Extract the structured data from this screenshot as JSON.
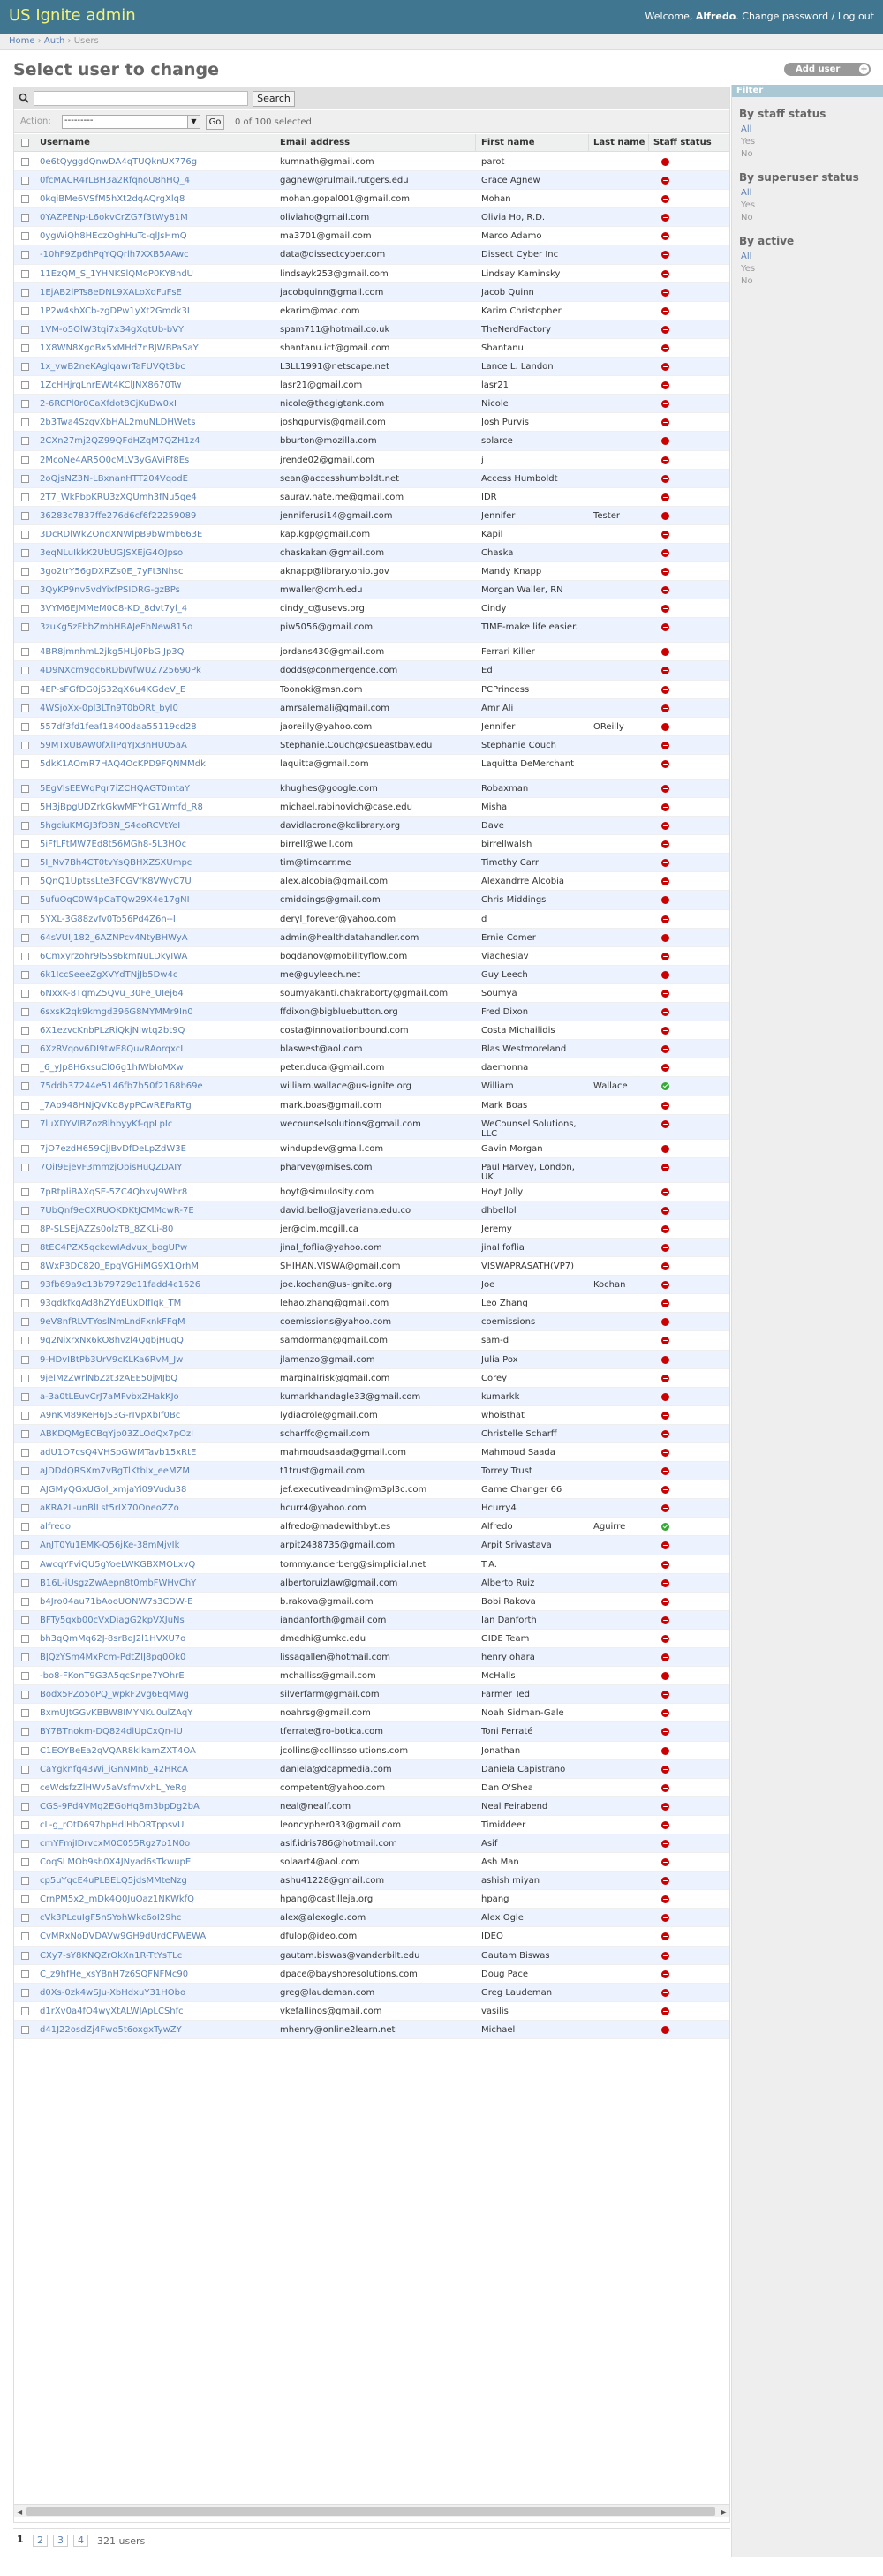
{
  "header": {
    "brand": "US Ignite admin",
    "welcome": "Welcome,",
    "user": "Alfredo",
    "change_password": "Change password",
    "sep": "/",
    "logout": "Log out"
  },
  "breadcrumbs": {
    "home": "Home",
    "auth": "Auth",
    "users": "Users",
    "sep": "›"
  },
  "page": {
    "title": "Select user to change",
    "add_button": "Add user",
    "add_icon": "plus-icon"
  },
  "search": {
    "button": "Search",
    "value": ""
  },
  "actions": {
    "label": "Action:",
    "select_value": "---------",
    "go": "Go",
    "selection_count": "0 of 100 selected"
  },
  "columns": {
    "username": "Username",
    "email": "Email address",
    "first": "First name",
    "last": "Last name",
    "staff": "Staff status"
  },
  "rows": [
    {
      "u": "0e6tQyggdQnwDA4qTUQknUX776g",
      "e": "kumnath@gmail.com",
      "f": "parot",
      "l": "",
      "s": false
    },
    {
      "u": "0fcMACR4rLBH3a2RfqnoU8hHQ_4",
      "e": "gagnew@rulmail.rutgers.edu",
      "f": "Grace Agnew",
      "l": "",
      "s": false
    },
    {
      "u": "0kqiBMe6VSfM5hXt2dqAQrgXlq8",
      "e": "mohan.gopal001@gmail.com",
      "f": "Mohan",
      "l": "",
      "s": false
    },
    {
      "u": "0YAZPENp-L6okvCrZG7f3tWy81M",
      "e": "oliviaho@gmail.com",
      "f": "Olivia Ho, R.D.",
      "l": "",
      "s": false
    },
    {
      "u": "0ygWiQh8HEczOghHuTc-qlJsHmQ",
      "e": "ma3701@gmail.com",
      "f": "Marco Adamo",
      "l": "",
      "s": false
    },
    {
      "u": "-10hF9Zp6hPqYQQrlh7XXB5AAwc",
      "e": "data@dissectcyber.com",
      "f": "Dissect Cyber Inc",
      "l": "",
      "s": false
    },
    {
      "u": "11EzQM_S_1YHNKSlQMoP0KY8ndU",
      "e": "lindsayk253@gmail.com",
      "f": "Lindsay Kaminsky",
      "l": "",
      "s": false
    },
    {
      "u": "1EjAB2lPTs8eDNL9XALoXdFuFsE",
      "e": "jacobquinn@gmail.com",
      "f": "Jacob Quinn",
      "l": "",
      "s": false
    },
    {
      "u": "1P2w4shXCb-zgDPw1yXt2Gmdk3I",
      "e": "ekarim@mac.com",
      "f": "Karim Christopher",
      "l": "",
      "s": false
    },
    {
      "u": "1VM-o5OlW3tqi7x34gXqtUb-bVY",
      "e": "spam711@hotmail.co.uk",
      "f": "TheNerdFactory",
      "l": "",
      "s": false
    },
    {
      "u": "1X8WN8XgoBx5xMHd7nBJWBPaSaY",
      "e": "shantanu.ict@gmail.com",
      "f": "Shantanu",
      "l": "",
      "s": false
    },
    {
      "u": "1x_vwB2neKAglqawrTaFUVQt3bc",
      "e": "L3LL1991@netscape.net",
      "f": "Lance L. Landon",
      "l": "",
      "s": false
    },
    {
      "u": "1ZcHHjrqLnrEWt4KClJNX8670Tw",
      "e": "lasr21@gmail.com",
      "f": "lasr21",
      "l": "",
      "s": false
    },
    {
      "u": "2-6RCPl0r0CaXfdot8CjKuDw0xI",
      "e": "nicole@thegigtank.com",
      "f": "Nicole",
      "l": "",
      "s": false
    },
    {
      "u": "2b3Twa4SzgvXbHAL2muNLDHWets",
      "e": "joshgpurvis@gmail.com",
      "f": "Josh Purvis",
      "l": "",
      "s": false
    },
    {
      "u": "2CXn27mj2QZ99QFdHZqM7QZH1z4",
      "e": "bburton@mozilla.com",
      "f": "solarce",
      "l": "",
      "s": false
    },
    {
      "u": "2McoNe4AR5O0cMLV3yGAViFf8Es",
      "e": "jrende02@gmail.com",
      "f": "j",
      "l": "",
      "s": false
    },
    {
      "u": "2oQjsNZ3N-LBxnanHTT204VqodE",
      "e": "sean@accesshumboldt.net",
      "f": "Access Humboldt",
      "l": "",
      "s": false
    },
    {
      "u": "2T7_WkPbpKRU3zXQUmh3fNu5ge4",
      "e": "saurav.hate.me@gmail.com",
      "f": "IDR",
      "l": "",
      "s": false
    },
    {
      "u": "36283c7837ffe276d6cf6f22259089",
      "e": "jenniferusi14@gmail.com",
      "f": "Jennifer",
      "l": "Tester",
      "s": false
    },
    {
      "u": "3DcRDlWkZOndXNWlpB9bWmb663E",
      "e": "kap.kgp@gmail.com",
      "f": "Kapil",
      "l": "",
      "s": false
    },
    {
      "u": "3eqNLuIkkK2UbUGJSXEjG4OJpso",
      "e": "chaskakani@gmail.com",
      "f": "Chaska",
      "l": "",
      "s": false
    },
    {
      "u": "3go2trY56gDXRZs0E_7yFt3Nhsc",
      "e": "aknapp@library.ohio.gov",
      "f": "Mandy Knapp",
      "l": "",
      "s": false
    },
    {
      "u": "3QyKP9nv5vdYixfPSIDRG-gzBPs",
      "e": "mwaller@cmh.edu",
      "f": "Morgan Waller, RN",
      "l": "",
      "s": false
    },
    {
      "u": "3VYM6EJMMeM0C8-KD_8dvt7yl_4",
      "e": "cindy_c@usevs.org",
      "f": "Cindy",
      "l": "",
      "s": false
    },
    {
      "u": "3zuKg5zFbbZmbHBAJeFhNew815o",
      "e": "piw5056@gmail.com",
      "f": "TIME-make life easier.",
      "l": "",
      "s": false,
      "tall": true
    },
    {
      "u": "4BR8jmnhmL2jkg5HLj0PbGIJp3Q",
      "e": "jordans430@gmail.com",
      "f": "Ferrari Killer",
      "l": "",
      "s": false
    },
    {
      "u": "4D9NXcm9gc6RDbWfWUZ725690Pk",
      "e": "dodds@conmergence.com",
      "f": "Ed",
      "l": "",
      "s": false
    },
    {
      "u": "4EP-sFGfDG0jS32qX6u4KGdeV_E",
      "e": "Toonoki@msn.com",
      "f": "PCPrincess",
      "l": "",
      "s": false
    },
    {
      "u": "4WSjoXx-0pl3LTn9T0bORt_byI0",
      "e": "amrsalemali@gmail.com",
      "f": "Amr Ali",
      "l": "",
      "s": false
    },
    {
      "u": "557df3fd1feaf18400daa55119cd28",
      "e": "jaoreilly@yahoo.com",
      "f": "Jennifer",
      "l": "OReilly",
      "s": false
    },
    {
      "u": "59MTxUBAW0fXlIPgYJx3nHU05aA",
      "e": "Stephanie.Couch@csueastbay.edu",
      "f": "Stephanie Couch",
      "l": "",
      "s": false
    },
    {
      "u": "5dkK1AOmR7HAQ4OcKPD9FQNMMdk",
      "e": "laquitta@gmail.com",
      "f": "Laquitta DeMerchant",
      "l": "",
      "s": false,
      "tall": true
    },
    {
      "u": "5EgVlsEEWqPqr7iZCHQAGT0mtaY",
      "e": "khughes@google.com",
      "f": "Robaxman",
      "l": "",
      "s": false
    },
    {
      "u": "5H3jBpgUDZrkGkwMFYhG1Wmfd_R8",
      "e": "michael.rabinovich@case.edu",
      "f": "Misha",
      "l": "",
      "s": false
    },
    {
      "u": "5hgciuKMGJ3fO8N_S4eoRCVtYeI",
      "e": "davidlacrone@kclibrary.org",
      "f": "Dave",
      "l": "",
      "s": false
    },
    {
      "u": "5iFfLFtMW7Ed8t56MGh8-5L3HOc",
      "e": "birrell@well.com",
      "f": "birrellwalsh",
      "l": "",
      "s": false
    },
    {
      "u": "5I_Nv7Bh4CT0tvYsQBHXZSXUmpc",
      "e": "tim@timcarr.me",
      "f": "Timothy Carr",
      "l": "",
      "s": false
    },
    {
      "u": "5QnQ1UptssLte3FCGVfK8VWyC7U",
      "e": "alex.alcobia@gmail.com",
      "f": "Alexandrre Alcobia",
      "l": "",
      "s": false
    },
    {
      "u": "5ufuOqC0W4pCaTQw29X4e17gNI",
      "e": "cmiddings@gmail.com",
      "f": "Chris Middings",
      "l": "",
      "s": false
    },
    {
      "u": "5YXL-3G88zvfv0To56Pd4Z6n--I",
      "e": "deryl_forever@yahoo.com",
      "f": "d",
      "l": "",
      "s": false
    },
    {
      "u": "64sVUIJ182_6AZNPcv4NtyBHWyA",
      "e": "admin@healthdatahandler.com",
      "f": "Ernie Comer",
      "l": "",
      "s": false
    },
    {
      "u": "6Cmxyrzohr9lSSs6kmNuLDkyIWA",
      "e": "bogdanov@mobilityflow.com",
      "f": "Viacheslav",
      "l": "",
      "s": false
    },
    {
      "u": "6k1IccSeeeZgXVYdTNjJb5Dw4c",
      "e": "me@guyleech.net",
      "f": "Guy Leech",
      "l": "",
      "s": false
    },
    {
      "u": "6NxxK-8TqmZ5Qvu_30Fe_UIej64",
      "e": "soumyakanti.chakraborty@gmail.com",
      "f": "Soumya",
      "l": "",
      "s": false
    },
    {
      "u": "6sxsK2qk9kmgd396G8MYMMr9In0",
      "e": "ffdixon@bigbluebutton.org",
      "f": "Fred Dixon",
      "l": "",
      "s": false
    },
    {
      "u": "6X1ezvcKnbPLzRiQkjNIwtq2bt9Q",
      "e": "costa@innovationbound.com",
      "f": "Costa Michailidis",
      "l": "",
      "s": false
    },
    {
      "u": "6XzRVqov6DI9twE8QuvRAorqxcI",
      "e": "blaswest@aol.com",
      "f": "Blas Westmoreland",
      "l": "",
      "s": false
    },
    {
      "u": "_6_yJp8H6xsuCl06g1hIWbIoMXw",
      "e": "peter.ducai@gmail.com",
      "f": "daemonna",
      "l": "",
      "s": false
    },
    {
      "u": "75ddb37244e5146fb7b50f2168b69e",
      "e": "william.wallace@us-ignite.org",
      "f": "William",
      "l": "Wallace",
      "s": true
    },
    {
      "u": "_7Ap948HNjQVKq8ypPCwREFaRTg",
      "e": "mark.boas@gmail.com",
      "f": "Mark Boas",
      "l": "",
      "s": false
    },
    {
      "u": "7luXDYVIBZoz8lhbyyKf-qpLpIc",
      "e": "wecounselsolutions@gmail.com",
      "f": "WeCounsel Solutions, LLC",
      "l": "",
      "s": false,
      "tall": true
    },
    {
      "u": "7jO7ezdH659CjJBvDfDeLpZdW3E",
      "e": "windupdev@gmail.com",
      "f": "Gavin Morgan",
      "l": "",
      "s": false
    },
    {
      "u": "7OiI9EjevF3mmzjOpisHuQZDAIY",
      "e": "pharvey@mises.com",
      "f": "Paul Harvey, London, UK",
      "l": "",
      "s": false,
      "tall": true
    },
    {
      "u": "7pRtpliBAXqSE-5ZC4QhxvJ9Wbr8",
      "e": "hoyt@simulosity.com",
      "f": "Hoyt Jolly",
      "l": "",
      "s": false
    },
    {
      "u": "7UbQnf9eCXRUOKDKtJCMMcwR-7E",
      "e": "david.bello@javeriana.edu.co",
      "f": "dhbellol",
      "l": "",
      "s": false
    },
    {
      "u": "8P-SLSEjAZZs0olzT8_8ZKLi-80",
      "e": "jer@cim.mcgill.ca",
      "f": "Jeremy",
      "l": "",
      "s": false
    },
    {
      "u": "8tEC4PZX5qckewIAdvux_bogUPw",
      "e": "jinal_foflia@yahoo.com",
      "f": "jinal foflia",
      "l": "",
      "s": false
    },
    {
      "u": "8WxP3DC820_EpqVGHiMG9X1QrhM",
      "e": "SHIHAN.VISWA@gmail.com",
      "f": "VISWAPRASATH(VP7)",
      "l": "",
      "s": false
    },
    {
      "u": "93fb69a9c13b79729c11fadd4c1626",
      "e": "joe.kochan@us-ignite.org",
      "f": "Joe",
      "l": "Kochan",
      "s": false
    },
    {
      "u": "93gdkfkqAd8hZYdEUxDlfIqk_TM",
      "e": "lehao.zhang@gmail.com",
      "f": "Leo Zhang",
      "l": "",
      "s": false
    },
    {
      "u": "9eV8nfRLVTYoslNmLndFxnkFFqM",
      "e": "coemissions@yahoo.com",
      "f": "coemissions",
      "l": "",
      "s": false
    },
    {
      "u": "9g2NixrxNx6kO8hvzl4QgbjHugQ",
      "e": "samdorman@gmail.com",
      "f": "sam-d",
      "l": "",
      "s": false
    },
    {
      "u": "9-HDvIBtPb3UrV9cKLKa6RvM_Jw",
      "e": "jlamenzo@gmail.com",
      "f": "Julia Pox",
      "l": "",
      "s": false
    },
    {
      "u": "9jelMzZwrlNbZzt3zAEE50jMJbQ",
      "e": "marginalrisk@gmail.com",
      "f": "Corey",
      "l": "",
      "s": false
    },
    {
      "u": "a-3a0tLEuvCrJ7aMFvbxZHakKJo",
      "e": "kumarkhandagle33@gmail.com",
      "f": "kumarkk",
      "l": "",
      "s": false
    },
    {
      "u": "A9nKM89KeH6JS3G-rIVpXbIf0Bc",
      "e": "lydiacrole@gmail.com",
      "f": "whoisthat",
      "l": "",
      "s": false
    },
    {
      "u": "ABKDQMgECBqYjp03ZLOdQx7pOzI",
      "e": "scharffc@gmail.com",
      "f": "Christelle Scharff",
      "l": "",
      "s": false
    },
    {
      "u": "adU1O7csQ4VHSpGWMTavb15xRtE",
      "e": "mahmoudsaada@gmail.com",
      "f": "Mahmoud Saada",
      "l": "",
      "s": false
    },
    {
      "u": "aJDDdQRSXm7vBgTlKtbIx_eeMZM",
      "e": "t1trust@gmail.com",
      "f": "Torrey Trust",
      "l": "",
      "s": false
    },
    {
      "u": "AJGMyQGxUGol_xmjaYi09Vudu38",
      "e": "jef.executiveadmin@m3pl3c.com",
      "f": "Game Changer 66",
      "l": "",
      "s": false
    },
    {
      "u": "aKRA2L-unBlLst5rIX70OneoZZo",
      "e": "hcurr4@yahoo.com",
      "f": "Hcurry4",
      "l": "",
      "s": false
    },
    {
      "u": "alfredo",
      "e": "alfredo@madewithbyt.es",
      "f": "Alfredo",
      "l": "Aguirre",
      "s": true
    },
    {
      "u": "AnJT0Yu1EMK-Q56jKe-38mMjvIk",
      "e": "arpit2438735@gmail.com",
      "f": "Arpit Srivastava",
      "l": "",
      "s": false
    },
    {
      "u": "AwcqYFviQU5gYoeLWKGBXMOLxvQ",
      "e": "tommy.anderberg@simplicial.net",
      "f": "T.A.",
      "l": "",
      "s": false
    },
    {
      "u": "B16L-iUsgzZwAepn8t0mbFWHvChY",
      "e": "albertoruizlaw@gmail.com",
      "f": "Alberto Ruiz",
      "l": "",
      "s": false
    },
    {
      "u": "b4Jro04au71bAooUONW7s3CDW-E",
      "e": "b.rakova@gmail.com",
      "f": "Bobi Rakova",
      "l": "",
      "s": false
    },
    {
      "u": "BFTy5qxb00cVxDiagG2kpVXJuNs",
      "e": "iandanforth@gmail.com",
      "f": "Ian Danforth",
      "l": "",
      "s": false
    },
    {
      "u": "bh3qQmMq62J-8srBdJ2l1HVXU7o",
      "e": "dmedhi@umkc.edu",
      "f": "GIDE Team",
      "l": "",
      "s": false
    },
    {
      "u": "BJQzYSm4MxPcm-PdtZIJ8pq0Ok0",
      "e": "lissagallen@hotmail.com",
      "f": "henry ohara",
      "l": "",
      "s": false
    },
    {
      "u": "-bo8-FKonT9G3A5qcSnpe7YOhrE",
      "e": "mchalliss@gmail.com",
      "f": "McHalls",
      "l": "",
      "s": false
    },
    {
      "u": "Bodx5PZo5oPQ_wpkF2vg6EqMwg",
      "e": "silverfarm@gmail.com",
      "f": "Farmer Ted",
      "l": "",
      "s": false
    },
    {
      "u": "BxmUJtGGvKBBW8IMYNKu0ulZAqY",
      "e": "noahrsg@gmail.com",
      "f": "Noah Sidman-Gale",
      "l": "",
      "s": false
    },
    {
      "u": "BY7BTnokm-DQ824dlUpCxQn-IU",
      "e": "tferrate@ro-botica.com",
      "f": "Toni Ferraté",
      "l": "",
      "s": false
    },
    {
      "u": "C1EOYBeEa2qVQAR8kIkamZXT4OA",
      "e": "jcollins@collinssolutions.com",
      "f": "Jonathan",
      "l": "",
      "s": false
    },
    {
      "u": "CaYgknfq43Wi_iGnNMnb_42HRcA",
      "e": "daniela@dcapmedia.com",
      "f": "Daniela Capistrano",
      "l": "",
      "s": false
    },
    {
      "u": "ceWdsfzZlHWv5aVsfmVxhL_YeRg",
      "e": "competent@yahoo.com",
      "f": "Dan O'Shea",
      "l": "",
      "s": false
    },
    {
      "u": "CGS-9Pd4VMq2EGoHq8m3bpDg2bA",
      "e": "neal@nealf.com",
      "f": "Neal Feirabend",
      "l": "",
      "s": false
    },
    {
      "u": "cL-g_rOtD697bpHdIHbORTppsvU",
      "e": "leoncypher033@gmail.com",
      "f": "Timiddeer",
      "l": "",
      "s": false
    },
    {
      "u": "cmYFmjIDrvcxM0C055Rgz7o1N0o",
      "e": "asif.idris786@hotmail.com",
      "f": "Asif",
      "l": "",
      "s": false
    },
    {
      "u": "CoqSLMOb9sh0X4JNyad6sTkwupE",
      "e": "solaart4@aol.com",
      "f": "Ash Man",
      "l": "",
      "s": false
    },
    {
      "u": "cp5uYqcE4uPLBELQ5jdsMMteNzg",
      "e": "ashu41228@gmail.com",
      "f": "ashish miyan",
      "l": "",
      "s": false
    },
    {
      "u": "CrnPM5x2_mDk4Q0JuOaz1NKWkfQ",
      "e": "hpang@castilleja.org",
      "f": "hpang",
      "l": "",
      "s": false
    },
    {
      "u": "cVk3PLcuIgF5nSYohWkc6oI29hc",
      "e": "alex@alexogle.com",
      "f": "Alex Ogle",
      "l": "",
      "s": false
    },
    {
      "u": "CvMRxNoDVDAVw9GH9dUrdCFWEWA",
      "e": "dfulop@ideo.com",
      "f": "IDEO",
      "l": "",
      "s": false
    },
    {
      "u": "CXy7-sY8KNQZrOkXn1R-TtYsTLc",
      "e": "gautam.biswas@vanderbilt.edu",
      "f": "Gautam Biswas",
      "l": "",
      "s": false
    },
    {
      "u": "C_z9hfHe_xsYBnH7z6SQFNFMc90",
      "e": "dpace@bayshoresolutions.com",
      "f": "Doug Pace",
      "l": "",
      "s": false
    },
    {
      "u": "d0Xs-0zk4wSJu-XbHdxuY31HObo",
      "e": "greg@laudeman.com",
      "f": "Greg Laudeman",
      "l": "",
      "s": false
    },
    {
      "u": "d1rXv0a4fO4wyXtALWJApLCShfc",
      "e": "vkefallinos@gmail.com",
      "f": "vasilis",
      "l": "",
      "s": false
    },
    {
      "u": "d41J22osdZj4Fwo5t6oxgxTywZY",
      "e": "mhenry@online2learn.net",
      "f": "Michael",
      "l": "",
      "s": false
    }
  ],
  "pagination": {
    "pages": [
      "1",
      "2",
      "3",
      "4"
    ],
    "count": "321 users"
  },
  "filter": {
    "title": "Filter",
    "groups": [
      {
        "title": "By staff status",
        "options": [
          "All",
          "Yes",
          "No"
        ]
      },
      {
        "title": "By superuser status",
        "options": [
          "All",
          "Yes",
          "No"
        ]
      },
      {
        "title": "By active",
        "options": [
          "All",
          "Yes",
          "No"
        ]
      }
    ]
  },
  "colors": {
    "header": "#417690",
    "brand": "#f4f379",
    "link": "#5b80b2",
    "no": "#cc0000",
    "yes": "#33aa33"
  }
}
